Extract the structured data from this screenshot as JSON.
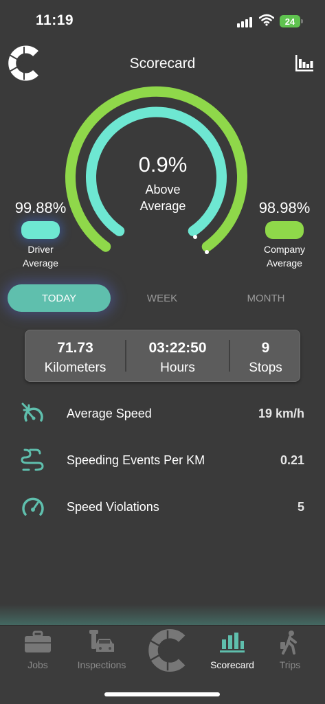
{
  "status": {
    "time": "11:19",
    "battery": "24"
  },
  "header": {
    "title": "Scorecard"
  },
  "gauge": {
    "percent": "0.9%",
    "subtitle_line1": "Above",
    "subtitle_line2": "Average",
    "driver_value": "99.88%",
    "driver_label_line1": "Driver",
    "driver_label_line2": "Average",
    "company_value": "98.98%",
    "company_label_line1": "Company",
    "company_label_line2": "Average",
    "driver_color": "#6ee7d2",
    "company_color": "#8fd84a"
  },
  "tabs": [
    {
      "label": "TODAY",
      "active": true
    },
    {
      "label": "WEEK",
      "active": false
    },
    {
      "label": "MONTH",
      "active": false
    }
  ],
  "stats": [
    {
      "value": "71.73",
      "label": "Kilometers"
    },
    {
      "value": "03:22:50",
      "label": "Hours"
    },
    {
      "value": "9",
      "label": "Stops"
    }
  ],
  "metrics": [
    {
      "icon": "speedometer-down-icon",
      "label": "Average Speed",
      "value": "19 km/h"
    },
    {
      "icon": "winding-road-icon",
      "label": "Speeding Events Per KM",
      "value": "0.21"
    },
    {
      "icon": "gauge-icon",
      "label": "Speed Violations",
      "value": "5"
    }
  ],
  "nav": [
    {
      "icon": "briefcase-icon",
      "label": "Jobs",
      "active": false
    },
    {
      "icon": "wrench-car-icon",
      "label": "Inspections",
      "active": false
    },
    {
      "icon": "app-logo-icon",
      "label": "",
      "active": false
    },
    {
      "icon": "bar-chart-icon",
      "label": "Scorecard",
      "active": true
    },
    {
      "icon": "walking-person-icon",
      "label": "Trips",
      "active": false
    }
  ]
}
